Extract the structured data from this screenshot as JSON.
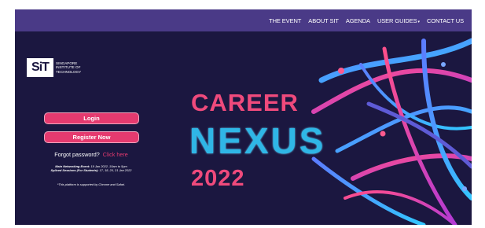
{
  "nav": {
    "items": [
      "THE EVENT",
      "ABOUT SIT",
      "AGENDA",
      "USER GUIDES",
      "CONTACT US"
    ],
    "dropdown_caret": "▾"
  },
  "logo": {
    "mark": "SiT",
    "text": "SINGAPORE INSTITUTE OF TECHNOLOGY"
  },
  "auth": {
    "login_label": "Login",
    "register_label": "Register Now",
    "forgot_text": "Forgot password?",
    "forgot_link": "Click here"
  },
  "info": {
    "line1_label": "Main Networking Event:",
    "line1_value": "19 Jan 2022, 10am to 5pm",
    "line2_label": "Spliced Sessions (For Students):",
    "line2_value": "17, 18, 20, 21 Jan 2022",
    "note": "*This platform is supported by Chrome and Safari."
  },
  "hero": {
    "line1": "CAREER",
    "line2": "NEXUS",
    "line3": "2022"
  },
  "colors": {
    "background": "#1b1740",
    "topbar": "#4a3a87",
    "accent_pink": "#e53a6f",
    "accent_blue": "#2fb6e6"
  }
}
